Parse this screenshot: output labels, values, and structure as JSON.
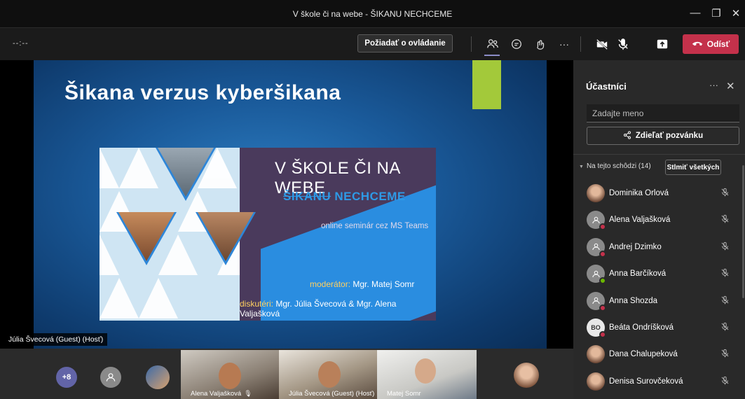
{
  "window": {
    "title": "V škole či na webe - ŠIKANU NECHCEME",
    "minimize_glyph": "—",
    "maximize_glyph": "❐",
    "close_glyph": "✕"
  },
  "toolbar": {
    "timer": "--:--",
    "request_control_label": "Požiadať o ovládanie",
    "leave_label": "Odísť",
    "more_glyph": "···",
    "icons": [
      "people-icon",
      "chat-icon",
      "reactions-icon",
      "more-icon",
      "camera-off-icon",
      "mic-off-icon",
      "share-tray-icon",
      "hangup-icon"
    ]
  },
  "slide": {
    "title": "Šikana verzus kyberšikana",
    "banner": {
      "line1": "V ŠKOLE ČI NA WEBE",
      "line2_strike": "ŠIKANU",
      "line2_rest": "NECHCEME",
      "subtitle": "online seminár cez MS Teams",
      "moderator_label": "moderátor:",
      "moderator_name": "Mgr. Matej Somr",
      "disputants_label": "diskutéri:",
      "disputants_names": "Mgr. Júlia Švecová & Mgr. Alena Valjašková"
    }
  },
  "stage": {
    "presenter_label": "Júlia Švecová (Guest) (Hosť)"
  },
  "gallery": {
    "overflow_count": "+8",
    "tiles": [
      {
        "name": "Alena Valjašková"
      },
      {
        "name": "Júlia Švecová (Guest) (Hosť)"
      },
      {
        "name": "Matej Somr"
      }
    ]
  },
  "panel": {
    "title": "Účastníci",
    "more_glyph": "···",
    "close_glyph": "✕",
    "search_placeholder": "Zadajte meno",
    "share_invite_label": "Zdieľať pozvánku",
    "section_label": "Na tejto schôdzi (14)",
    "mute_all_label": "Stlmiť všetkých",
    "participants": [
      {
        "name": "Dominika Orlová",
        "avatar": "photo",
        "initials": ""
      },
      {
        "name": "Alena Valjašková",
        "avatar": "generic",
        "initials": "",
        "status": "#c4314b"
      },
      {
        "name": "Andrej Dzimko",
        "avatar": "generic",
        "initials": "",
        "status": "#c4314b"
      },
      {
        "name": "Anna Barčíková",
        "avatar": "generic",
        "initials": "",
        "status": "#6bb700"
      },
      {
        "name": "Anna Shozda",
        "avatar": "generic",
        "initials": "",
        "status": "#c4314b"
      },
      {
        "name": "Beáta Ondríšková",
        "avatar": "initials",
        "initials": "BO",
        "status": "#c4314b"
      },
      {
        "name": "Dana Chalupeková",
        "avatar": "photo",
        "initials": ""
      },
      {
        "name": "Denisa Surovčeková",
        "avatar": "photo",
        "initials": ""
      }
    ]
  },
  "colors": {
    "accent": "#8b8cc7",
    "leave": "#c4314b",
    "status_busy": "#c4314b",
    "status_available": "#6bb700"
  }
}
